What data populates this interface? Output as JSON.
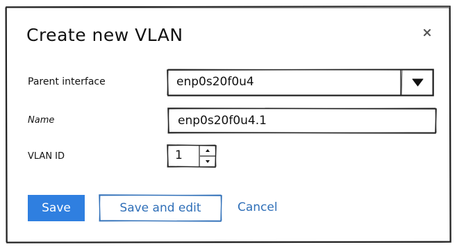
{
  "dialog": {
    "title": "Create new VLAN",
    "close_icon": "close-icon"
  },
  "form": {
    "parent_interface": {
      "label": "Parent interface",
      "value": "enp0s20f0u4",
      "icon": "caret-down-icon"
    },
    "name": {
      "label": "Name",
      "value": "enp0s20f0u4.1"
    },
    "vlan_id": {
      "label": "VLAN ID",
      "value": "1",
      "up_icon": "caret-up-icon",
      "down_icon": "caret-down-icon"
    }
  },
  "actions": {
    "save_label": "Save",
    "save_and_edit_label": "Save and edit",
    "cancel_label": "Cancel"
  },
  "colors": {
    "primary": "#2f7fe0",
    "link": "#2f6fb8",
    "border": "#222222"
  }
}
